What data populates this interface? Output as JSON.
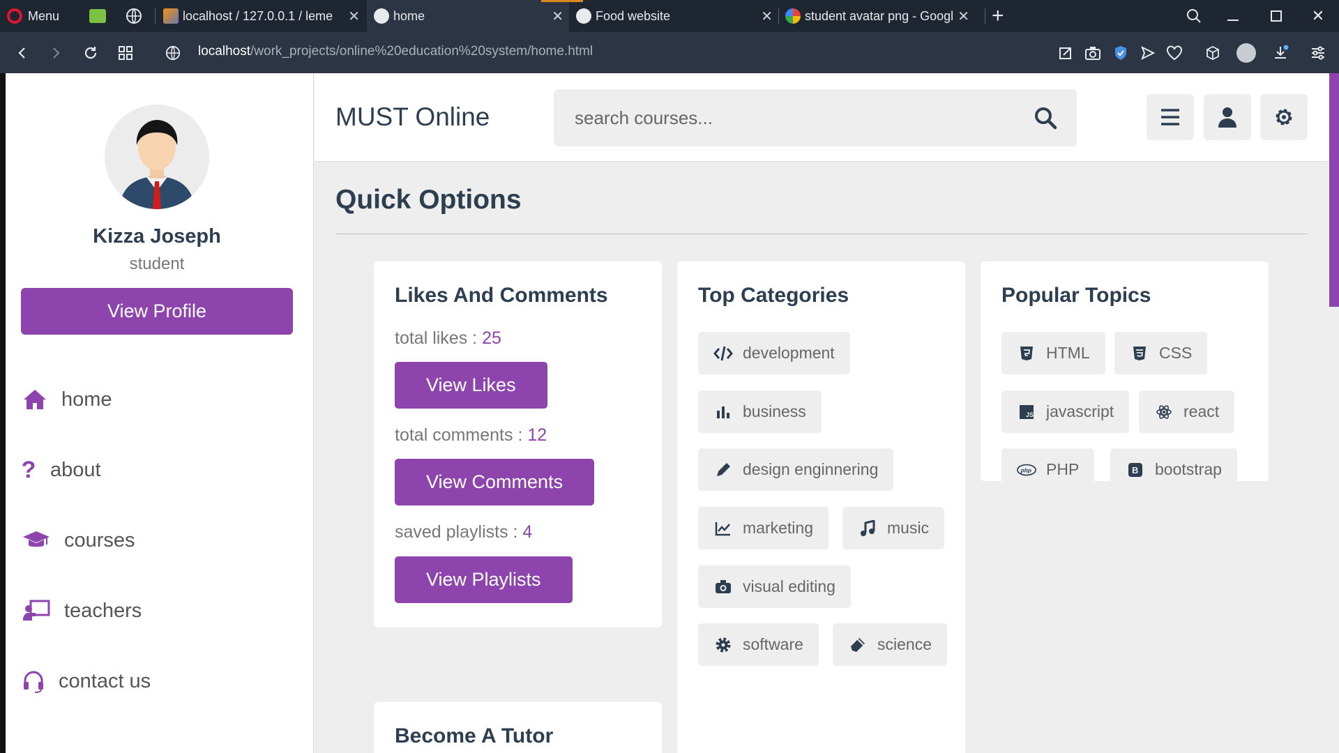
{
  "browser": {
    "menu_label": "Menu",
    "tabs": [
      {
        "title": "localhost / 127.0.0.1 / leme",
        "favicon": "phpmyadmin-icon"
      },
      {
        "title": "home",
        "favicon": "globe-icon"
      },
      {
        "title": "Food website",
        "favicon": "globe-icon"
      },
      {
        "title": "student avatar png - Googl",
        "favicon": "google-icon"
      }
    ],
    "url_host": "localhost",
    "url_path": "/work_projects/online%20education%20system/home.html"
  },
  "colors": {
    "accent": "#8e44ad",
    "heading": "#2c3e50",
    "text": "#777777",
    "background": "#eeeeee"
  },
  "sidebar": {
    "name": "Kizza Joseph",
    "role": "student",
    "profile_button": "View Profile",
    "items": [
      {
        "label": "home",
        "icon": "home-icon"
      },
      {
        "label": "about",
        "icon": "question-icon"
      },
      {
        "label": "courses",
        "icon": "graduation-cap-icon"
      },
      {
        "label": "teachers",
        "icon": "teacher-icon"
      },
      {
        "label": "contact us",
        "icon": "headset-icon"
      }
    ]
  },
  "header": {
    "logo": "MUST Online",
    "search_placeholder": "search courses..."
  },
  "main": {
    "title": "Quick Options",
    "likes_card": {
      "title": "Likes And Comments",
      "likes_label": "total likes : ",
      "likes_value": "25",
      "likes_button": "View Likes",
      "comments_label": "total comments : ",
      "comments_value": "12",
      "comments_button": "View Comments",
      "playlists_label": "saved playlists : ",
      "playlists_value": "4",
      "playlists_button": "View Playlists"
    },
    "categories_card": {
      "title": "Top Categories",
      "items": [
        {
          "label": "development",
          "icon": "code-icon"
        },
        {
          "label": "business",
          "icon": "chart-bar-icon"
        },
        {
          "label": "design enginnering",
          "icon": "pen-icon"
        },
        {
          "label": "marketing",
          "icon": "chart-line-icon"
        },
        {
          "label": "music",
          "icon": "music-icon"
        },
        {
          "label": "visual editing",
          "icon": "camera-icon"
        },
        {
          "label": "software",
          "icon": "cog-icon"
        },
        {
          "label": "science",
          "icon": "vial-icon"
        }
      ]
    },
    "topics_card": {
      "title": "Popular Topics",
      "items": [
        {
          "label": "HTML",
          "icon": "html5-icon"
        },
        {
          "label": "CSS",
          "icon": "css3-icon"
        },
        {
          "label": "javascript",
          "icon": "js-icon"
        },
        {
          "label": "react",
          "icon": "react-icon"
        },
        {
          "label": "PHP",
          "icon": "php-icon"
        },
        {
          "label": "bootstrap",
          "icon": "bootstrap-icon"
        }
      ]
    },
    "tutor_card": {
      "title": "Become A Tutor"
    }
  }
}
